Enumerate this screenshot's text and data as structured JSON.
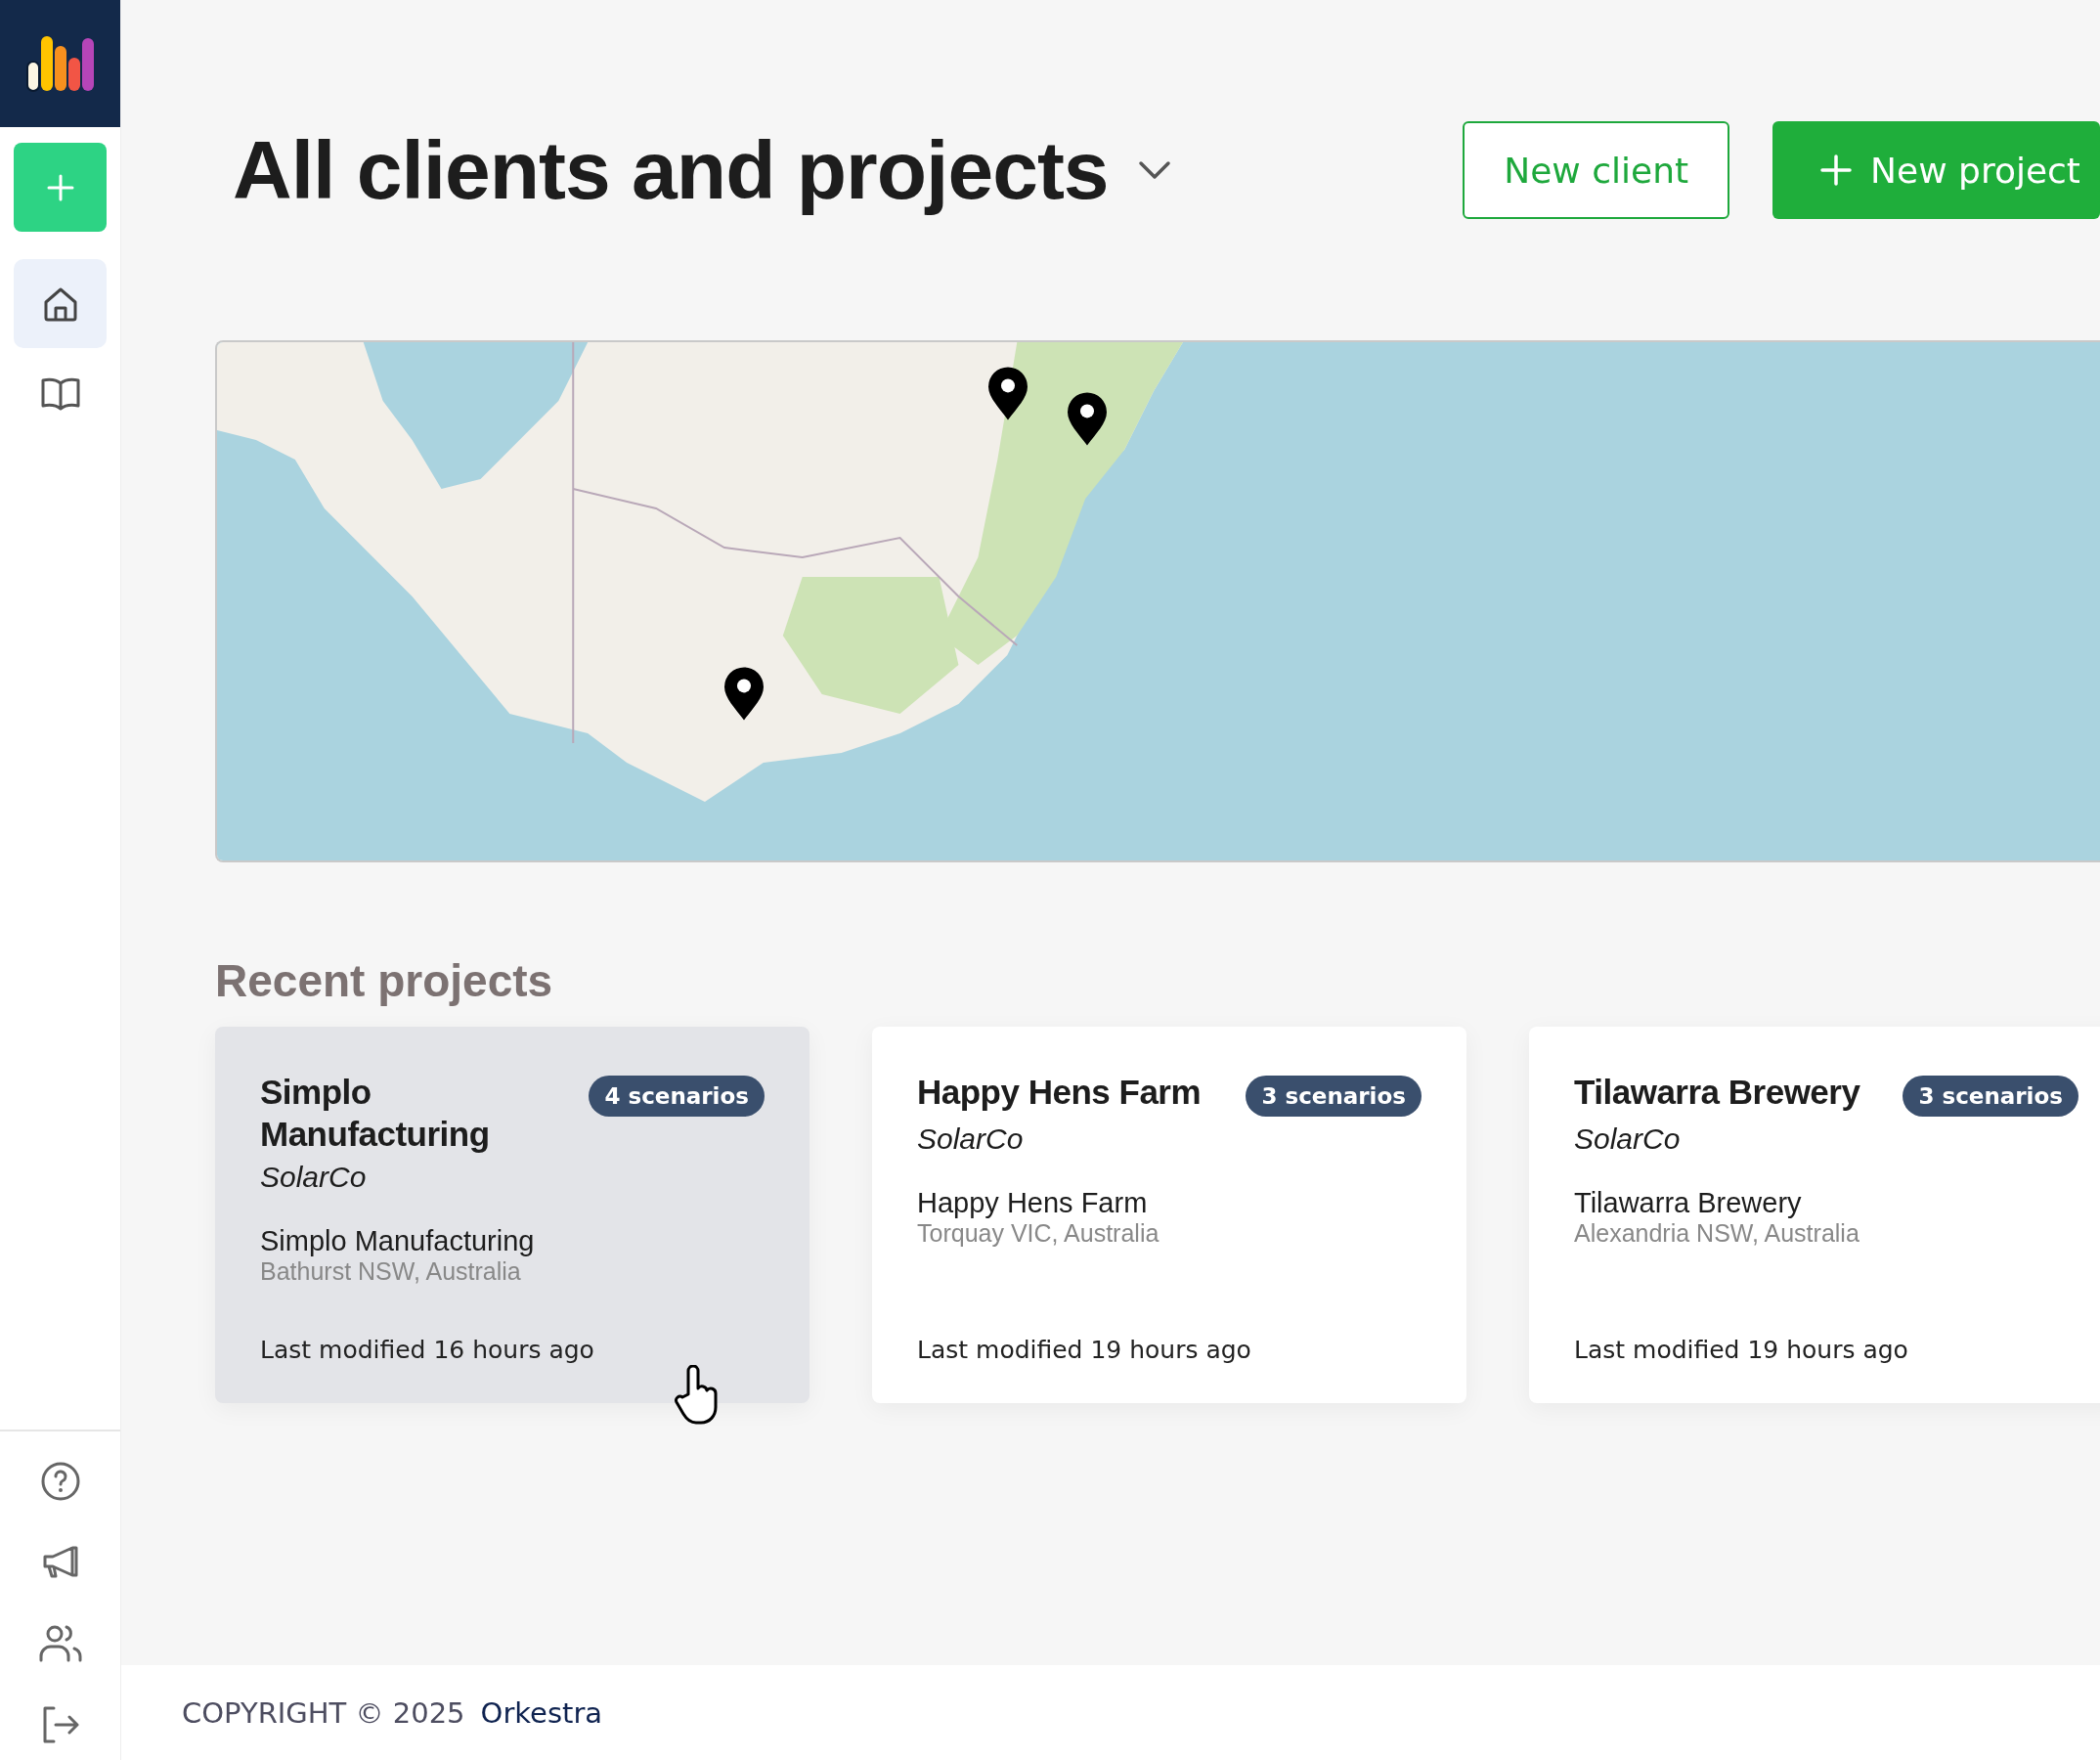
{
  "sidebar": {
    "nav": [
      {
        "kind": "home",
        "selected": true
      },
      {
        "kind": "book",
        "selected": false
      }
    ]
  },
  "header": {
    "title": "All clients and projects",
    "buttons": [
      {
        "kind": "outline",
        "label": "New client"
      },
      {
        "kind": "primary",
        "label": "New project"
      }
    ]
  },
  "recent": {
    "heading": "Recent projects",
    "cards": [
      {
        "title": "Simplo Manufacturing",
        "badge": "4 scenarios",
        "client": "SolarCo",
        "site": "Simplo Manufacturing",
        "address": "Bathurst NSW, Australia",
        "modified": "Last modified 16 hours ago",
        "hovered": true
      },
      {
        "title": "Happy Hens Farm",
        "badge": "3 scenarios",
        "client": "SolarCo",
        "site": "Happy Hens Farm",
        "address": "Torquay VIC, Australia",
        "modified": "Last modified 19 hours ago",
        "hovered": false
      },
      {
        "title": "Tilawarra Brewery",
        "badge": "3 scenarios",
        "client": "SolarCo",
        "site": "Tilawarra Brewery",
        "address": "Alexandria NSW, Australia",
        "modified": "Last modified 19 hours ago",
        "hovered": false
      }
    ]
  },
  "footer": {
    "copyright": "COPYRIGHT © 2025",
    "brand": "Orkestra"
  }
}
